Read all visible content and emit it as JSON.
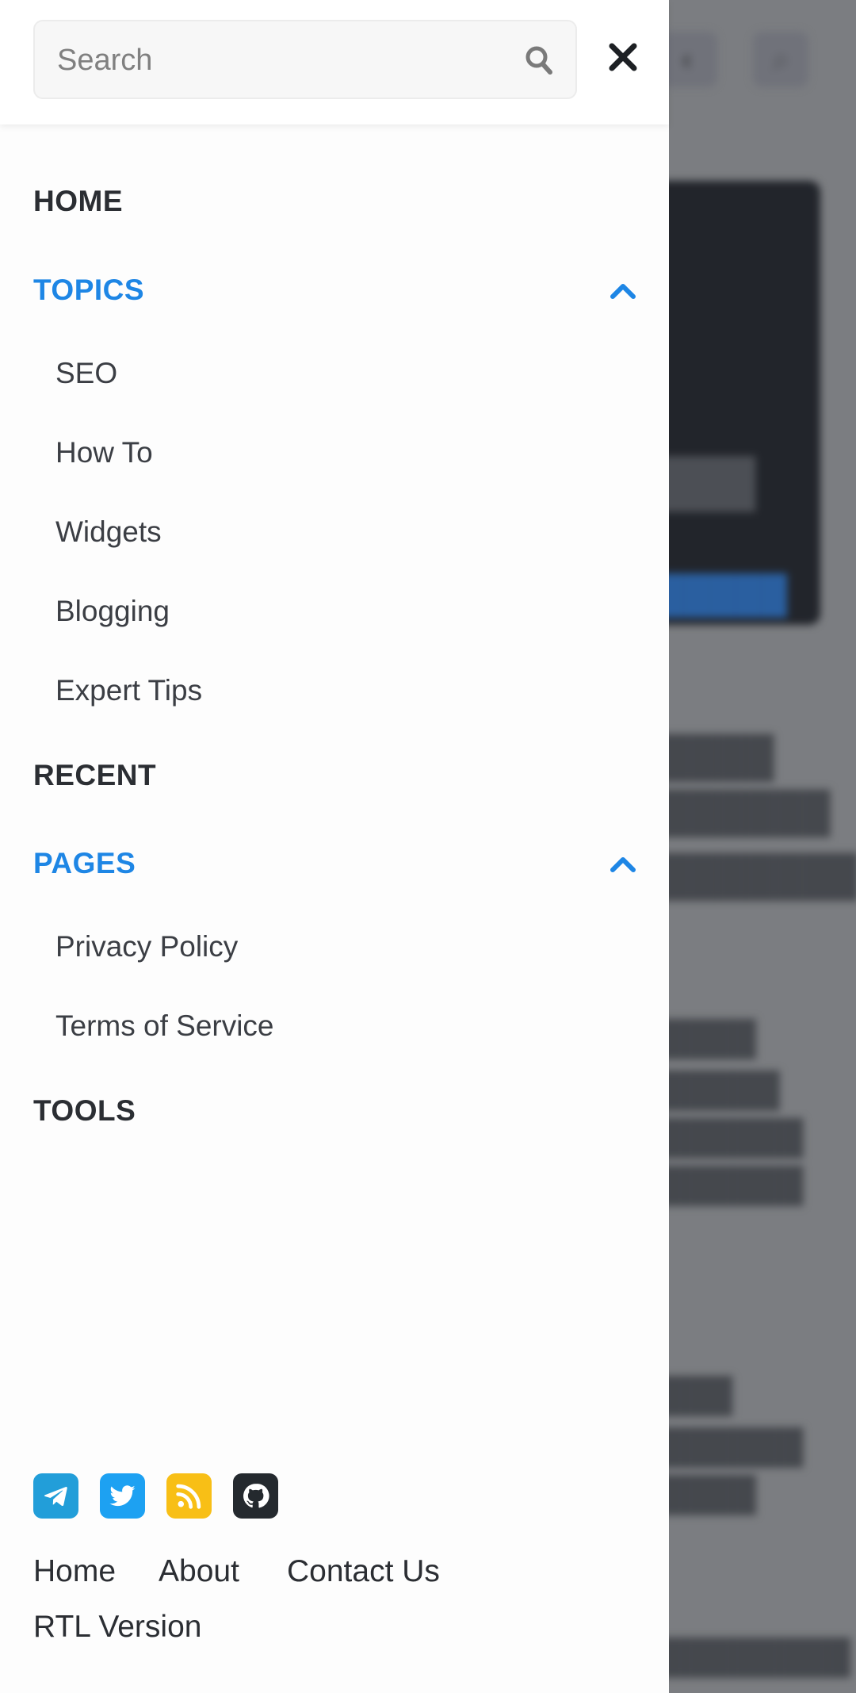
{
  "search": {
    "placeholder": "Search"
  },
  "nav": {
    "home": "HOME",
    "topics": {
      "label": "TOPICS",
      "items": [
        "SEO",
        "How To",
        "Widgets",
        "Blogging",
        "Expert Tips"
      ]
    },
    "recent": "RECENT",
    "pages": {
      "label": "PAGES",
      "items": [
        "Privacy Policy",
        "Terms of Service"
      ]
    },
    "tools": "TOOLS"
  },
  "socials": [
    {
      "name": "telegram",
      "color": "#229ed9"
    },
    {
      "name": "twitter",
      "color": "#1da1f2"
    },
    {
      "name": "rss",
      "color": "#f8bf16"
    },
    {
      "name": "github",
      "color": "#24292e"
    }
  ],
  "footer": {
    "links": [
      "Home",
      "About",
      "Contact Us"
    ],
    "rtl": "RTL Version"
  },
  "colors": {
    "accent": "#1e86e5",
    "text": "#2b2e33",
    "overlay": "#7b7d81"
  }
}
